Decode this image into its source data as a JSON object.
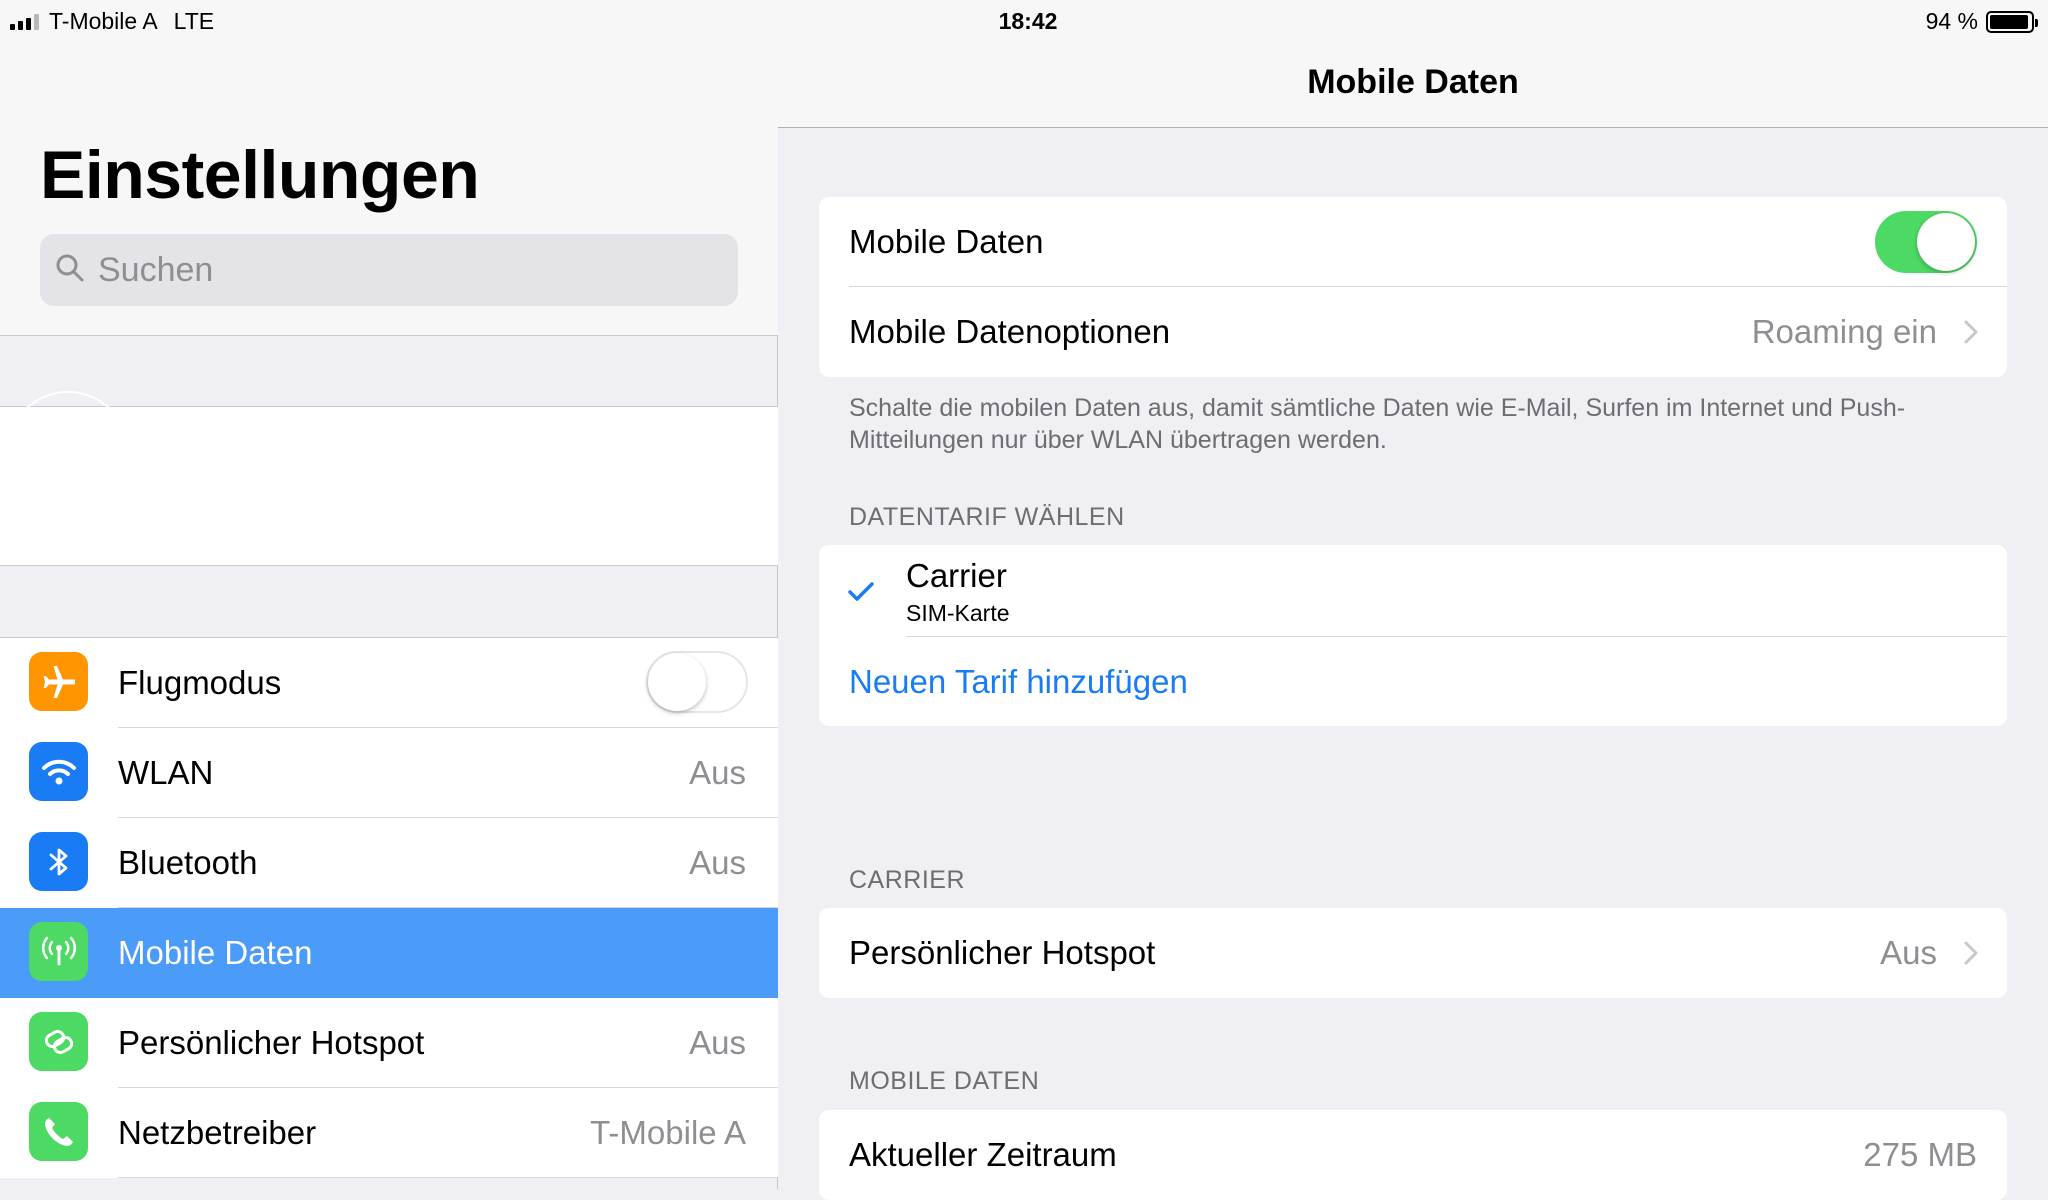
{
  "status_bar": {
    "carrier": "T-Mobile A",
    "network": "LTE",
    "time": "18:42",
    "battery": "94 %",
    "battery_level": 0.94
  },
  "sidebar": {
    "title": "Einstellungen",
    "search_placeholder": "Suchen",
    "items": [
      {
        "label": "Flugmodus",
        "value": "",
        "icon": "airplane-icon",
        "color": "#ff9500",
        "toggle": false
      },
      {
        "label": "WLAN",
        "value": "Aus",
        "icon": "wifi-icon",
        "color": "#1a7cf5"
      },
      {
        "label": "Bluetooth",
        "value": "Aus",
        "icon": "bluetooth-icon",
        "color": "#1a7cf5"
      },
      {
        "label": "Mobile Daten",
        "value": "",
        "icon": "cellular-antenna-icon",
        "color": "#4cd964",
        "selected": true
      },
      {
        "label": "Persönlicher Hotspot",
        "value": "Aus",
        "icon": "hotspot-link-icon",
        "color": "#4cd964"
      },
      {
        "label": "Netzbetreiber",
        "value": "T-Mobile A",
        "icon": "phone-icon",
        "color": "#4cd964"
      }
    ]
  },
  "detail": {
    "nav_title": "Mobile Daten",
    "main_card": {
      "mobile_data_label": "Mobile Daten",
      "mobile_data_on": true,
      "options_label": "Mobile Datenoptionen",
      "options_value": "Roaming ein"
    },
    "footnote": "Schalte die mobilen Daten aus, damit sämtliche Daten wie E-Mail, Surfen im Internet und Push-Mitteilungen nur über WLAN übertragen werden.",
    "plan_section": {
      "header": "DATENTARIF WÄHLEN",
      "plan_name": "Carrier",
      "plan_sub": "SIM-Karte",
      "add_plan": "Neuen Tarif hinzufügen"
    },
    "carrier_section": {
      "header": "CARRIER",
      "hotspot_label": "Persönlicher Hotspot",
      "hotspot_value": "Aus"
    },
    "usage_section": {
      "header": "MOBILE DATEN",
      "period_label": "Aktueller Zeitraum",
      "period_value": "275 MB"
    }
  }
}
